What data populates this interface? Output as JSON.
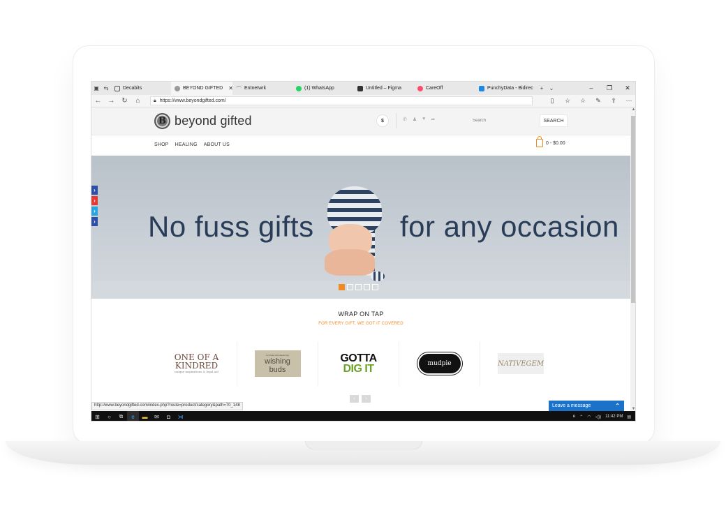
{
  "browser": {
    "tabs": [
      {
        "label": "Decabits",
        "color": "#888888",
        "active": false
      },
      {
        "label": "BEYOND GIFTED",
        "color": "#9a9a9a",
        "active": true
      },
      {
        "label": "Entnetwrk",
        "color": "#cccccc",
        "active": false
      },
      {
        "label": "(1) WhatsApp",
        "color": "#25d366",
        "active": false
      },
      {
        "label": "Untitled – Figma",
        "color": "#333333",
        "active": false
      },
      {
        "label": "CareOff",
        "color": "#ff4d6d",
        "active": false
      },
      {
        "label": "PunchyData - Bidirec",
        "color": "#1e88e5",
        "active": false
      }
    ],
    "url": "https://www.beyondgifted.com/"
  },
  "site": {
    "logo_letter": "B",
    "logo_text": "beyond gifted",
    "currency": "$",
    "search_placeholder": "Search",
    "search_button": "SEARCH",
    "nav": [
      "SHOP",
      "HEALING",
      "ABOUT US"
    ],
    "cart": "0 - $0.00",
    "hero_left": "No fuss gifts",
    "hero_right": "for any occasion",
    "section_title": "WRAP ON TAP",
    "section_subtitle": "FOR EVERY GIFT, WE GOT IT COVERED",
    "brands": {
      "b1_line1": "ONE OF A",
      "b1_line2": "KINDRED",
      "b1_tag": "unique inspirations & legal aid",
      "b2_tag": "for those who dream big",
      "b2_line1": "wishing",
      "b2_line2": "buds",
      "b3_line1": "GOTTA",
      "b3_line2": "DIG IT",
      "b4": "mudpie",
      "b5_line1": "NATIVE",
      "b5_line2": "GEM"
    }
  },
  "status_url": "http://www.beyondgifted.com/index.php?route=product/category&path=70_148",
  "chat": "Leave a message",
  "taskbar": {
    "time": "11:42 PM"
  },
  "colors": {
    "accent": "#f28a24",
    "hero_text": "#2a3d58",
    "chat": "#1a73c8"
  }
}
